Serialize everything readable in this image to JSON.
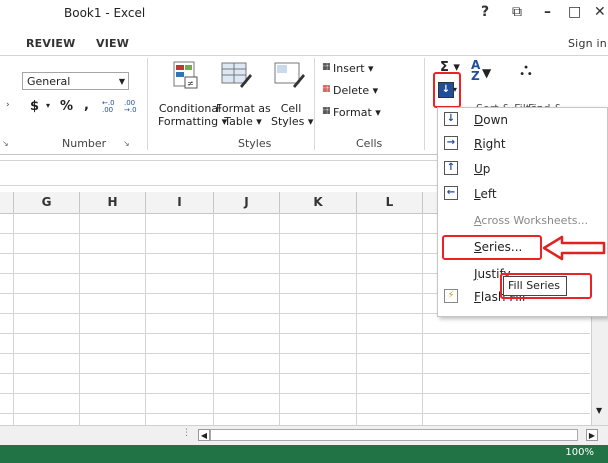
{
  "window": {
    "title": "Book1 - Excel",
    "help": "?",
    "restore": "⧉",
    "minimize": "–",
    "maximize": "□",
    "close": "✕"
  },
  "tabs": {
    "review": "REVIEW",
    "view": "VIEW",
    "signin": "Sign in"
  },
  "number_group": {
    "format_value": "General",
    "currency": "$",
    "percent": "%",
    "comma": ",",
    "inc_decimal": "←.0 .00",
    "dec_decimal": ".00 →.0",
    "label": "Number"
  },
  "styles_group": {
    "conditional": "Conditional\nFormatting ▾",
    "format_as_table": "Format as\nTable ▾",
    "cell_styles": "Cell\nStyles ▾",
    "label": "Styles"
  },
  "cells_group": {
    "insert": "Insert ▾",
    "delete": "Delete ▾",
    "format": "Format ▾",
    "label": "Cells"
  },
  "editing_group": {
    "sigma": "Σ ▾",
    "sort": "Sort & Filter",
    "find": "Find &"
  },
  "columns": [
    "G",
    "H",
    "I",
    "J",
    "K",
    "L"
  ],
  "fill_menu": {
    "items": [
      {
        "label": "Down",
        "icon": "↓"
      },
      {
        "label": "Right",
        "icon": "→"
      },
      {
        "label": "Up",
        "icon": "↑"
      },
      {
        "label": "Left",
        "icon": "←"
      },
      {
        "label": "Across Worksheets..."
      },
      {
        "label": "Series..."
      },
      {
        "label": "Justify"
      },
      {
        "label": "Flash Fill"
      }
    ]
  },
  "tooltip": "Fill Series",
  "status": {
    "zoom": "100%"
  },
  "colors": {
    "accent_red": "#e22222",
    "status_green": "#217346"
  }
}
